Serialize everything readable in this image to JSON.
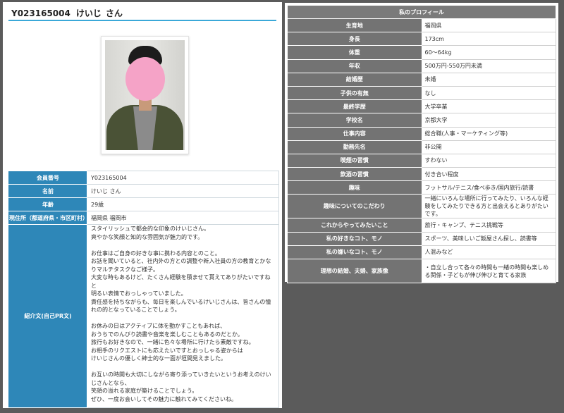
{
  "profile": {
    "member_id": "Y023165004",
    "name": "けいじ",
    "honorific": "さん"
  },
  "info_table": {
    "member_no_label": "会員番号",
    "member_no_value": "Y023165004",
    "name_label": "名前",
    "name_value": "けいじ さん",
    "age_label": "年齢",
    "age_value": "29歳",
    "address_label": "現住所（都道府県・市区町村）",
    "address_value": "福岡県 福岡市",
    "pr_label": "紹介文(自己PR文)",
    "pr_text": "スタイリッシュで都会的な印象のけいじさん。\n爽やかな笑顔と知的な雰囲気が魅力的です。\n\nお仕事はご自身の好きな事に携わる内容とのこと。\nお話を聞いていると、社内外の方との調整や新入社員の方の教育とかなりマルチタスクなご様子。\n大変な時もあるけど、たくさん経験を積ませて貰えてありがたいですねと\n明るい表情でおっしゃっていました。\n責任感を持ちながらも、毎日を楽しんでいるけいじさんは、皆さんの憧れの的となっていることでしょう。\n\nお休みの日はアクティブに体を動かすこともあれば、\nおうちでのんびり読書や音楽を楽しむこともあるのだとか。\n旅行もお好きなので、一緒に色々な場所に行けたら素敵ですね。\nお相手のリクエストにも応えたいですとおっしゃる姿からは\nけいじさんの優しく紳士的な一面が垣間見えました。\n\nお互いの時間も大切にしながら寄り添っていきたいというお考えのけいじさんとなら、\n笑顔の溢れる家庭が築けることでしょう。\nぜひ、一度お会いしてその魅力に触れてみてくださいね。"
  },
  "my_profile": {
    "header": "私のプロフィール",
    "rows": [
      {
        "label": "生育地",
        "value": "福岡県"
      },
      {
        "label": "身長",
        "value": "173cm"
      },
      {
        "label": "体重",
        "value": "60〜64kg"
      },
      {
        "label": "年収",
        "value": "500万円-550万円未満"
      },
      {
        "label": "結婚歴",
        "value": "未婚"
      },
      {
        "label": "子供の有無",
        "value": "なし"
      },
      {
        "label": "最終学歴",
        "value": "大学卒業"
      },
      {
        "label": "学校名",
        "value": "京都大学"
      },
      {
        "label": "仕事内容",
        "value": "総合職(人事・マーケティング等)"
      },
      {
        "label": "勤務先名",
        "value": "非公開"
      },
      {
        "label": "喫煙の習慣",
        "value": "すわない"
      },
      {
        "label": "飲酒の習慣",
        "value": "付き合い程度"
      },
      {
        "label": "趣味",
        "value": "フットサル/テニス/食べ歩き/国内旅行/読書"
      },
      {
        "label": "趣味についてのこだわり",
        "value": "一緒にいろんな場所に行ってみたり、いろんな経験をしてみたりできる方と出会えるとありがたいです。"
      },
      {
        "label": "これからやってみたいこと",
        "value": "旅行・キャンプ、テニス挑戦等"
      },
      {
        "label": "私の好きなコト、モノ",
        "value": "スポーツ、美味しいご飯屋さん探し、読書等"
      },
      {
        "label": "私の嫌いなコト、モノ",
        "value": "人混みなど"
      },
      {
        "label": "理想の結婚、夫婦、家族像",
        "value": "・自立し合って各々の時間も一緒の時間も楽しめる関係・子どもが伸び伸びと育てる家族"
      }
    ]
  },
  "colors": {
    "left_header_bg": "#2e87b8",
    "title_underline": "#3aa8d8",
    "right_header_bg": "#737373",
    "page_bg": "#5b5b5b"
  }
}
